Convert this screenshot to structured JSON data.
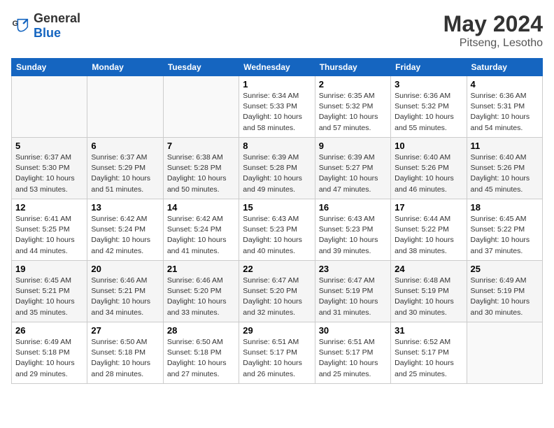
{
  "header": {
    "logo_general": "General",
    "logo_blue": "Blue",
    "month_year": "May 2024",
    "location": "Pitseng, Lesotho"
  },
  "days_of_week": [
    "Sunday",
    "Monday",
    "Tuesday",
    "Wednesday",
    "Thursday",
    "Friday",
    "Saturday"
  ],
  "weeks": [
    [
      {
        "day": "",
        "info": ""
      },
      {
        "day": "",
        "info": ""
      },
      {
        "day": "",
        "info": ""
      },
      {
        "day": "1",
        "info": "Sunrise: 6:34 AM\nSunset: 5:33 PM\nDaylight: 10 hours\nand 58 minutes."
      },
      {
        "day": "2",
        "info": "Sunrise: 6:35 AM\nSunset: 5:32 PM\nDaylight: 10 hours\nand 57 minutes."
      },
      {
        "day": "3",
        "info": "Sunrise: 6:36 AM\nSunset: 5:32 PM\nDaylight: 10 hours\nand 55 minutes."
      },
      {
        "day": "4",
        "info": "Sunrise: 6:36 AM\nSunset: 5:31 PM\nDaylight: 10 hours\nand 54 minutes."
      }
    ],
    [
      {
        "day": "5",
        "info": "Sunrise: 6:37 AM\nSunset: 5:30 PM\nDaylight: 10 hours\nand 53 minutes."
      },
      {
        "day": "6",
        "info": "Sunrise: 6:37 AM\nSunset: 5:29 PM\nDaylight: 10 hours\nand 51 minutes."
      },
      {
        "day": "7",
        "info": "Sunrise: 6:38 AM\nSunset: 5:28 PM\nDaylight: 10 hours\nand 50 minutes."
      },
      {
        "day": "8",
        "info": "Sunrise: 6:39 AM\nSunset: 5:28 PM\nDaylight: 10 hours\nand 49 minutes."
      },
      {
        "day": "9",
        "info": "Sunrise: 6:39 AM\nSunset: 5:27 PM\nDaylight: 10 hours\nand 47 minutes."
      },
      {
        "day": "10",
        "info": "Sunrise: 6:40 AM\nSunset: 5:26 PM\nDaylight: 10 hours\nand 46 minutes."
      },
      {
        "day": "11",
        "info": "Sunrise: 6:40 AM\nSunset: 5:26 PM\nDaylight: 10 hours\nand 45 minutes."
      }
    ],
    [
      {
        "day": "12",
        "info": "Sunrise: 6:41 AM\nSunset: 5:25 PM\nDaylight: 10 hours\nand 44 minutes."
      },
      {
        "day": "13",
        "info": "Sunrise: 6:42 AM\nSunset: 5:24 PM\nDaylight: 10 hours\nand 42 minutes."
      },
      {
        "day": "14",
        "info": "Sunrise: 6:42 AM\nSunset: 5:24 PM\nDaylight: 10 hours\nand 41 minutes."
      },
      {
        "day": "15",
        "info": "Sunrise: 6:43 AM\nSunset: 5:23 PM\nDaylight: 10 hours\nand 40 minutes."
      },
      {
        "day": "16",
        "info": "Sunrise: 6:43 AM\nSunset: 5:23 PM\nDaylight: 10 hours\nand 39 minutes."
      },
      {
        "day": "17",
        "info": "Sunrise: 6:44 AM\nSunset: 5:22 PM\nDaylight: 10 hours\nand 38 minutes."
      },
      {
        "day": "18",
        "info": "Sunrise: 6:45 AM\nSunset: 5:22 PM\nDaylight: 10 hours\nand 37 minutes."
      }
    ],
    [
      {
        "day": "19",
        "info": "Sunrise: 6:45 AM\nSunset: 5:21 PM\nDaylight: 10 hours\nand 35 minutes."
      },
      {
        "day": "20",
        "info": "Sunrise: 6:46 AM\nSunset: 5:21 PM\nDaylight: 10 hours\nand 34 minutes."
      },
      {
        "day": "21",
        "info": "Sunrise: 6:46 AM\nSunset: 5:20 PM\nDaylight: 10 hours\nand 33 minutes."
      },
      {
        "day": "22",
        "info": "Sunrise: 6:47 AM\nSunset: 5:20 PM\nDaylight: 10 hours\nand 32 minutes."
      },
      {
        "day": "23",
        "info": "Sunrise: 6:47 AM\nSunset: 5:19 PM\nDaylight: 10 hours\nand 31 minutes."
      },
      {
        "day": "24",
        "info": "Sunrise: 6:48 AM\nSunset: 5:19 PM\nDaylight: 10 hours\nand 30 minutes."
      },
      {
        "day": "25",
        "info": "Sunrise: 6:49 AM\nSunset: 5:19 PM\nDaylight: 10 hours\nand 30 minutes."
      }
    ],
    [
      {
        "day": "26",
        "info": "Sunrise: 6:49 AM\nSunset: 5:18 PM\nDaylight: 10 hours\nand 29 minutes."
      },
      {
        "day": "27",
        "info": "Sunrise: 6:50 AM\nSunset: 5:18 PM\nDaylight: 10 hours\nand 28 minutes."
      },
      {
        "day": "28",
        "info": "Sunrise: 6:50 AM\nSunset: 5:18 PM\nDaylight: 10 hours\nand 27 minutes."
      },
      {
        "day": "29",
        "info": "Sunrise: 6:51 AM\nSunset: 5:17 PM\nDaylight: 10 hours\nand 26 minutes."
      },
      {
        "day": "30",
        "info": "Sunrise: 6:51 AM\nSunset: 5:17 PM\nDaylight: 10 hours\nand 25 minutes."
      },
      {
        "day": "31",
        "info": "Sunrise: 6:52 AM\nSunset: 5:17 PM\nDaylight: 10 hours\nand 25 minutes."
      },
      {
        "day": "",
        "info": ""
      }
    ]
  ]
}
